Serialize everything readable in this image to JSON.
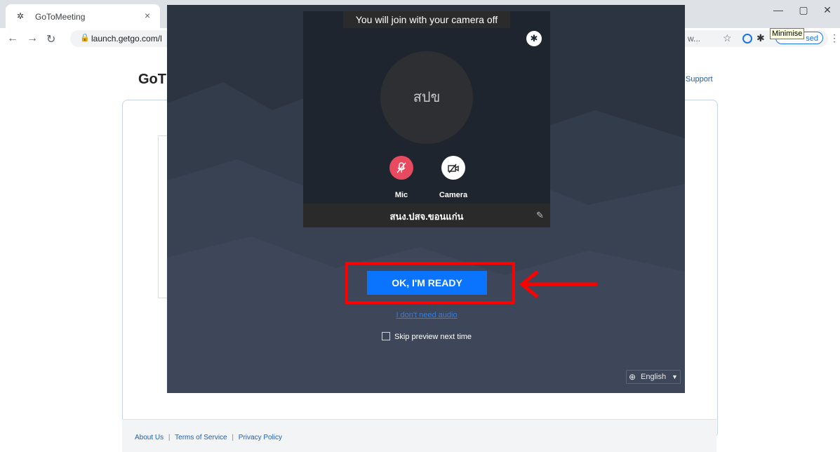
{
  "browser": {
    "tab_title": "GoToMeeting",
    "tab_close": "×",
    "url": "launch.getgo.com/l",
    "url_tail": "w...",
    "profile_status": "sed",
    "tooltip": "Minimise",
    "window_min": "—",
    "window_restore": "▢",
    "window_close": "✕"
  },
  "page": {
    "logo": "GoT",
    "support_link": "Support",
    "footer": {
      "about": "About Us",
      "terms": "Terms of Service",
      "privacy": "Privacy Policy",
      "separator": "|"
    }
  },
  "modal": {
    "camera_banner": "You will join with your camera off",
    "avatar_initials": "สปข",
    "mic_label": "Mic",
    "camera_label": "Camera",
    "display_name": "สนง.ปสจ.ขอนแก่น",
    "ready_button": "OK, I'M READY",
    "no_audio_link": "I don't need audio",
    "skip_preview": "Skip preview next time",
    "language": "English"
  },
  "colors": {
    "modal_bg": "#2c3442",
    "ready_button": "#0b74ff",
    "mic_muted": "#e84a5f",
    "highlight": "#ff0000"
  },
  "icons": {
    "tab_favicon": "gotomeeting-icon",
    "settings": "gear-icon",
    "mic": "mic-off-icon",
    "camera": "camera-off-icon",
    "edit": "pencil-icon",
    "language": "globe-icon"
  }
}
